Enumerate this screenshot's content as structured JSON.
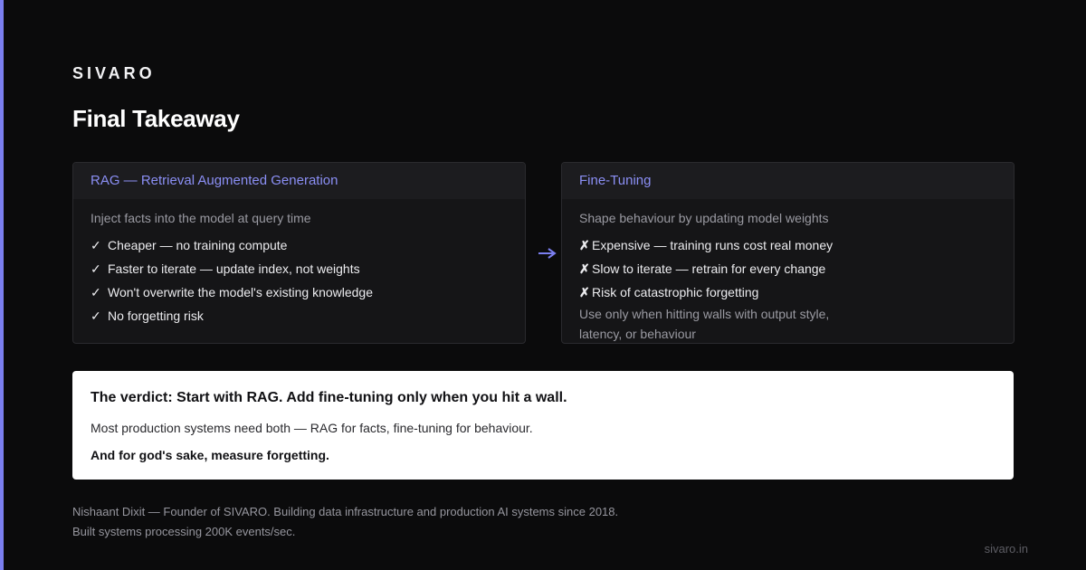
{
  "brand": "SIVARO",
  "title": "Final Takeaway",
  "colors": {
    "accent": "#7b7ff0",
    "background": "#0b0b0c",
    "card_title": "#8b8ff5"
  },
  "rag": {
    "title": "RAG — Retrieval Augmented Generation",
    "subtitle": "Inject facts into the model at query time",
    "items": [
      {
        "icon": "check-icon",
        "mark": "✓",
        "text": "Cheaper — no training compute"
      },
      {
        "icon": "check-icon",
        "mark": "✓",
        "text": "Faster to iterate — update index, not weights"
      },
      {
        "icon": "check-icon",
        "mark": "✓",
        "text": "Won't overwrite the model's existing knowledge"
      },
      {
        "icon": "check-icon",
        "mark": "✓",
        "text": "No forgetting risk"
      }
    ]
  },
  "connector": {
    "icon": "arrow-right-icon"
  },
  "finetune": {
    "title": "Fine-Tuning",
    "subtitle": "Shape behaviour by updating model weights",
    "items": [
      {
        "icon": "cross-icon",
        "mark": "✗",
        "text": "Expensive — training runs cost real money"
      },
      {
        "icon": "cross-icon",
        "mark": "✗",
        "text": "Slow to iterate — retrain for every change"
      },
      {
        "icon": "cross-icon",
        "mark": "✗",
        "text": "Risk of catastrophic forgetting"
      }
    ],
    "note_line1": "Use only when hitting walls with output style,",
    "note_line2": "latency, or behaviour"
  },
  "verdict": {
    "title": "The verdict: Start with RAG. Add fine-tuning only when you hit a wall.",
    "line": "Most production systems need both — RAG for facts, fine-tuning for behaviour.",
    "strong": "And for god's sake, measure forgetting."
  },
  "footer": {
    "line1": "Nishaant Dixit — Founder of SIVARO. Building data infrastructure and production AI systems since 2018.",
    "line2": "Built systems processing 200K events/sec."
  },
  "site": "sivaro.in"
}
